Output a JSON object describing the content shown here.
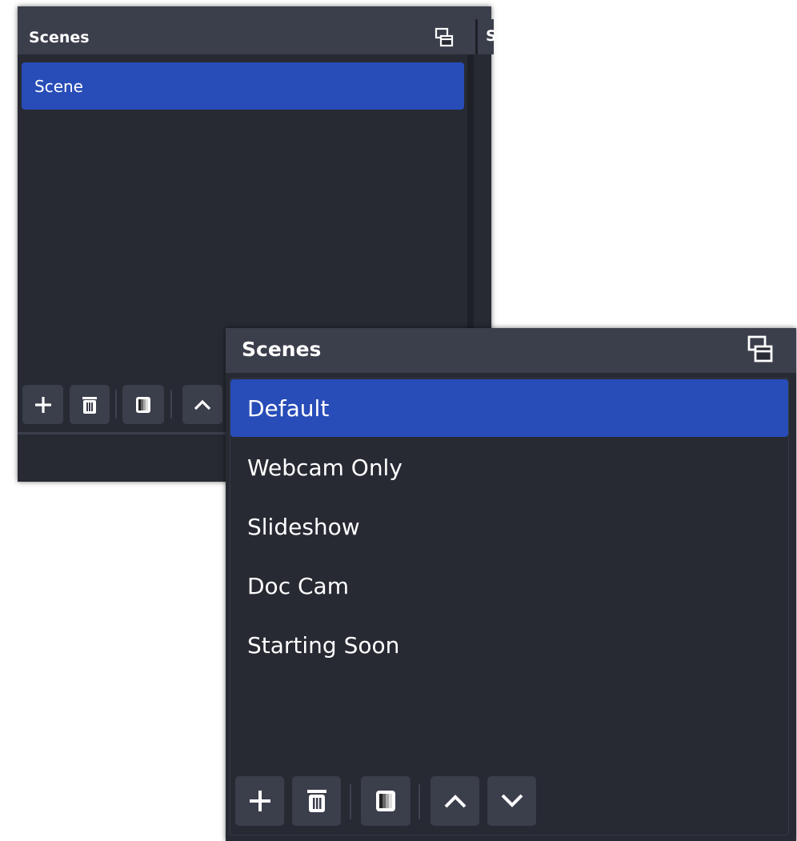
{
  "colors": {
    "panel_bg": "#272a33",
    "header_bg": "#3b3e4b",
    "selected": "#284cb8",
    "text": "#ffffff"
  },
  "back_panel": {
    "title": "Scenes",
    "partial_next_title": "S",
    "scenes": [
      {
        "label": "Scene",
        "selected": true
      }
    ],
    "toolbar_icons": [
      "add-icon",
      "trash-icon",
      "filter-icon",
      "chevron-up-icon"
    ]
  },
  "front_panel": {
    "title": "Scenes",
    "scenes": [
      {
        "label": "Default",
        "selected": true
      },
      {
        "label": "Webcam Only",
        "selected": false
      },
      {
        "label": "Slideshow",
        "selected": false
      },
      {
        "label": "Doc Cam",
        "selected": false
      },
      {
        "label": "Starting Soon",
        "selected": false
      }
    ],
    "toolbar_icons": [
      "add-icon",
      "trash-icon",
      "filter-icon",
      "chevron-up-icon",
      "chevron-down-icon"
    ]
  }
}
